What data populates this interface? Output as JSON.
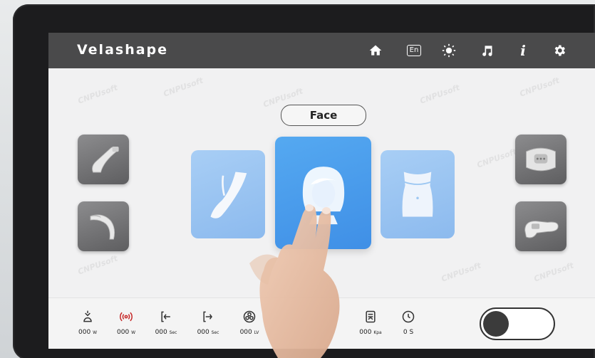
{
  "header": {
    "brand": "Velashape",
    "icons": [
      "home-icon",
      "language-icon",
      "brightness-icon",
      "music-icon",
      "info-icon",
      "settings-icon"
    ],
    "language_label": "En",
    "info_label": "i"
  },
  "treatment": {
    "selected_area": "Face",
    "areas": [
      "leg",
      "face",
      "abdomen"
    ]
  },
  "handpieces": {
    "left": [
      "large-applicator",
      "small-applicator"
    ],
    "right": [
      "roller-applicator",
      "vacuum-applicator"
    ]
  },
  "status": [
    {
      "icon": "ir-icon",
      "value": "000",
      "unit": "W"
    },
    {
      "icon": "rf-icon",
      "value": "000",
      "unit": "W"
    },
    {
      "icon": "pulse-in-icon",
      "value": "000",
      "unit": "Sec"
    },
    {
      "icon": "pulse-out-icon",
      "value": "000",
      "unit": "Sec"
    },
    {
      "icon": "vacuum-level-icon",
      "value": "000",
      "unit": "LV"
    },
    {
      "icon": "pressure-icon",
      "value": "000",
      "unit": "Kpa"
    },
    {
      "icon": "timer-icon",
      "value": "0",
      "unit": "S"
    }
  ],
  "power_toggle": {
    "state": "off"
  },
  "watermark_text": "CNPUsoft",
  "colors": {
    "header": "#4a4a4b",
    "accent": "#4a9cee",
    "card_light": "#9cc7f2"
  }
}
